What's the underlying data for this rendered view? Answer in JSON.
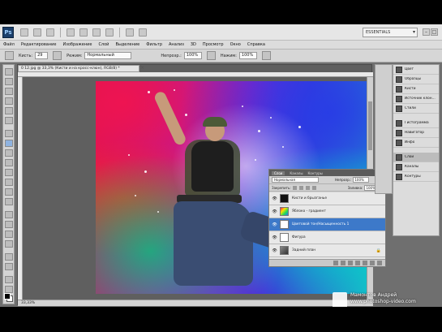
{
  "app": {
    "logo_text": "Ps",
    "workspace": "ESSENTIALS",
    "win_controls": [
      "–",
      "□",
      "×"
    ]
  },
  "menu": [
    "Файл",
    "Редактирование",
    "Изображение",
    "Слой",
    "Выделение",
    "Фильтр",
    "Анализ",
    "3D",
    "Просмотр",
    "Окно",
    "Справка"
  ],
  "options": {
    "brush_label": "Кисть:",
    "brush_size": "29",
    "mode_label": "Режим:",
    "mode_value": "Нормальный",
    "opacity_label": "Непрозр.:",
    "opacity_value": "100%",
    "flow_label": "Нажим:",
    "flow_value": "100%"
  },
  "document": {
    "tab_title": "0 12.jpg @ 33,3% (Кисти и на кросс-клюн), RGB/8) *",
    "tab_close": "×",
    "status": "33,33%"
  },
  "layers_panel": {
    "tabs": [
      "Слои",
      "Каналы",
      "Контуры"
    ],
    "blend_mode": "Нормальная",
    "opacity_label": "Непрозр.:",
    "opacity_value": "100%",
    "lock_label": "Закрепить:",
    "fill_label": "Заливка:",
    "fill_value": "100%",
    "layers": [
      {
        "name": "Кисти и брызганье",
        "thumb": "sparkle",
        "selected": false,
        "visible": true
      },
      {
        "name": "Яблоко - градиент",
        "thumb": "gradient",
        "selected": false,
        "visible": true
      },
      {
        "name": "Цветовой тон/Насыщенность 1",
        "thumb": "fill",
        "selected": true,
        "visible": true
      },
      {
        "name": "Фигура",
        "thumb": "fill",
        "selected": false,
        "visible": true
      },
      {
        "name": "Задний план",
        "thumb": "bg",
        "selected": false,
        "visible": true,
        "locked": true
      }
    ]
  },
  "dock": [
    {
      "label": "Цвет",
      "icon": "color-icon"
    },
    {
      "label": "Образцы",
      "icon": "swatches-icon"
    },
    {
      "label": "Кисти",
      "icon": "brushes-icon"
    },
    {
      "label": "Источник клон...",
      "icon": "clone-source-icon"
    },
    {
      "label": "Стили",
      "icon": "styles-icon"
    },
    {
      "label": "Гистограмма",
      "icon": "histogram-icon",
      "gap": true
    },
    {
      "label": "Навигатор",
      "icon": "navigator-icon"
    },
    {
      "label": "Инфо",
      "icon": "info-icon"
    },
    {
      "label": "Слои",
      "icon": "layers-icon",
      "gap": true,
      "highlight": true
    },
    {
      "label": "Каналы",
      "icon": "channels-icon"
    },
    {
      "label": "Контуры",
      "icon": "paths-icon"
    }
  ],
  "watermark": {
    "line1": "Мамонтов Андрей",
    "line2": "www.photoshop-video.com"
  }
}
